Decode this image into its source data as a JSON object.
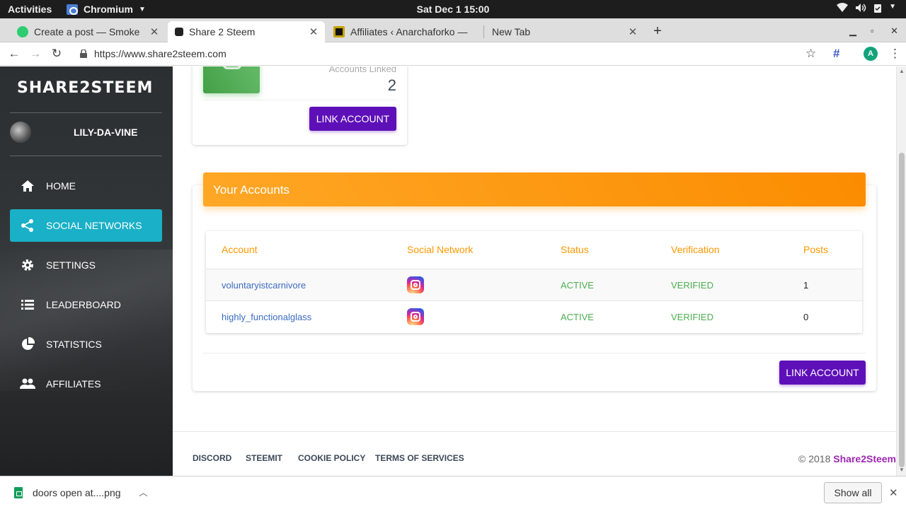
{
  "os_bar": {
    "activities": "Activities",
    "app_name": "Chromium",
    "clock": "Sat Dec 1  15:00"
  },
  "tabs": [
    {
      "title": "Create a post — Smoke",
      "favicon_color": "#2ecc71"
    },
    {
      "title": "Share 2 Steem",
      "favicon_color": "#222222"
    },
    {
      "title": "Affiliates ‹ Anarchaforko —",
      "favicon_color": "#c5a300"
    },
    {
      "title": "New Tab",
      "favicon_color": ""
    }
  ],
  "toolbar": {
    "url": "https://www.share2steem.com"
  },
  "sidebar": {
    "logo": "SHARE2STEEM",
    "username": "LILY-DA-VINE",
    "items": [
      {
        "label": "HOME",
        "icon": "home-icon"
      },
      {
        "label": "SOCIAL NETWORKS",
        "icon": "share-icon"
      },
      {
        "label": "SETTINGS",
        "icon": "gear-icon"
      },
      {
        "label": "LEADERBOARD",
        "icon": "list-icon"
      },
      {
        "label": "STATISTICS",
        "icon": "pie-chart-icon"
      },
      {
        "label": "AFFILIATES",
        "icon": "people-icon"
      }
    ],
    "active_color": "#1ab0c7"
  },
  "stats_card": {
    "category": "Accounts Linked",
    "value": "2",
    "button": "LINK ACCOUNT"
  },
  "accounts_card": {
    "title": "Your Accounts",
    "columns": [
      "Account",
      "Social Network",
      "Status",
      "Verification",
      "Posts"
    ],
    "rows": [
      {
        "account": "voluntaryistcarnivore",
        "network": "instagram-icon",
        "status": "ACTIVE",
        "verification": "VERIFIED",
        "posts": "1"
      },
      {
        "account": "highly_functionalglass",
        "network": "instagram-icon",
        "status": "ACTIVE",
        "verification": "VERIFIED",
        "posts": "0"
      }
    ],
    "button": "LINK ACCOUNT",
    "header_color": "#fb8c00",
    "button_color": "#5e10b8"
  },
  "footer": {
    "links": [
      "DISCORD",
      "STEEMIT",
      "COOKIE POLICY",
      "TERMS OF SERVICES"
    ],
    "copyright": "© 2018 ",
    "brand": "Share2Steem"
  },
  "download_shelf": {
    "filename": "doors open at....png",
    "show_all": "Show all"
  }
}
